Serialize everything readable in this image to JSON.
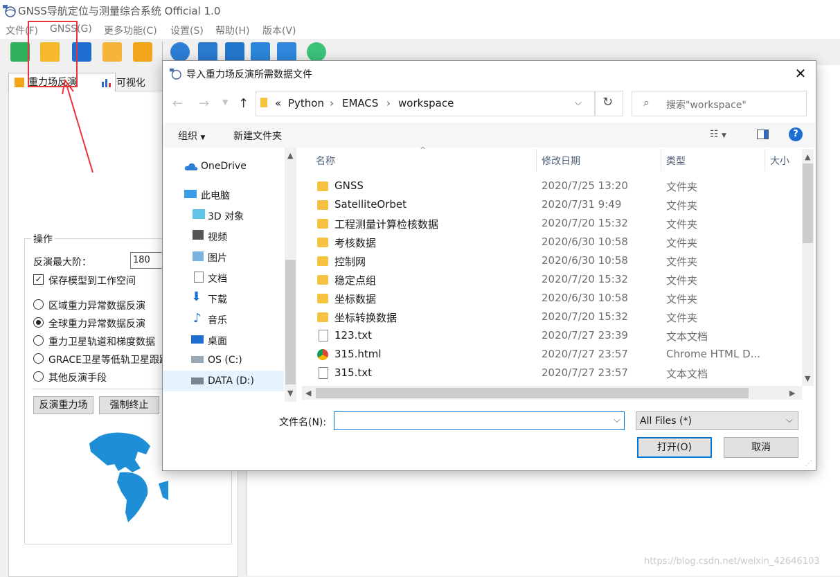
{
  "app": {
    "title": "GNSS导航定位与测量综合系统 Official 1.0",
    "menu": [
      "文件(F)",
      "GNSS(G)",
      "更多功能(C)",
      "设置(S)",
      "帮助(H)",
      "版本(V)"
    ]
  },
  "left_panel": {
    "tabs": [
      "重力场反演",
      "可视化"
    ],
    "group_title": "操作",
    "max_degree_label": "反演最大阶：",
    "max_degree_value": "180",
    "save_model_label": "保存模型到工作空间",
    "save_model_checked": true,
    "options": [
      {
        "label": "区域重力异常数据反演",
        "selected": false
      },
      {
        "label": "全球重力异常数据反演",
        "selected": true
      },
      {
        "label": "重力卫星轨道和梯度数据",
        "selected": false
      },
      {
        "label": "GRACE卫星等低轨卫星跟踪",
        "selected": false
      },
      {
        "label": "其他反演手段",
        "selected": false
      }
    ],
    "invert_button": "反演重力场",
    "stop_button": "强制终止"
  },
  "dialog": {
    "title": "导入重力场反演所需数据文件",
    "breadcrumb_prefix": "«",
    "breadcrumb": [
      "Python",
      "EMACS",
      "workspace"
    ],
    "search_placeholder": "搜索\"workspace\"",
    "organize_label": "组织",
    "new_folder_label": "新建文件夹",
    "nav_items": [
      {
        "label": "OneDrive",
        "icon": "cloud-icon"
      },
      {
        "label": "此电脑",
        "icon": "computer-icon"
      },
      {
        "label": "3D 对象",
        "icon": "cube-icon"
      },
      {
        "label": "视频",
        "icon": "video-icon"
      },
      {
        "label": "图片",
        "icon": "picture-icon"
      },
      {
        "label": "文档",
        "icon": "document-icon"
      },
      {
        "label": "下载",
        "icon": "download-icon"
      },
      {
        "label": "音乐",
        "icon": "music-icon"
      },
      {
        "label": "桌面",
        "icon": "desktop-icon"
      },
      {
        "label": "OS (C:)",
        "icon": "drive-icon"
      },
      {
        "label": "DATA (D:)",
        "icon": "drive-icon"
      }
    ],
    "columns": [
      "名称",
      "修改日期",
      "类型",
      "大小"
    ],
    "files": [
      {
        "name": "GNSS",
        "date": "2020/7/25 13:20",
        "type": "文件夹",
        "icon": "folder-icon"
      },
      {
        "name": "SatelliteOrbet",
        "date": "2020/7/31 9:49",
        "type": "文件夹",
        "icon": "folder-icon"
      },
      {
        "name": "工程测量计算检核数据",
        "date": "2020/7/20 15:32",
        "type": "文件夹",
        "icon": "folder-icon"
      },
      {
        "name": "考核数据",
        "date": "2020/6/30 10:58",
        "type": "文件夹",
        "icon": "folder-icon"
      },
      {
        "name": "控制网",
        "date": "2020/6/30 10:58",
        "type": "文件夹",
        "icon": "folder-icon"
      },
      {
        "name": "稳定点组",
        "date": "2020/7/20 15:32",
        "type": "文件夹",
        "icon": "folder-icon"
      },
      {
        "name": "坐标数据",
        "date": "2020/6/30 10:58",
        "type": "文件夹",
        "icon": "folder-icon"
      },
      {
        "name": "坐标转换数据",
        "date": "2020/7/20 15:32",
        "type": "文件夹",
        "icon": "folder-icon"
      },
      {
        "name": "123.txt",
        "date": "2020/7/27 23:39",
        "type": "文本文档",
        "icon": "text-file-icon"
      },
      {
        "name": "315.html",
        "date": "2020/7/27 23:57",
        "type": "Chrome HTML D...",
        "icon": "chrome-icon"
      },
      {
        "name": "315.txt",
        "date": "2020/7/27 23:57",
        "type": "文本文档",
        "icon": "text-file-icon"
      }
    ],
    "filename_label": "文件名(N):",
    "filename_value": "",
    "filter_value": "All Files (*)",
    "open_button": "打开(O)",
    "cancel_button": "取消"
  },
  "watermark": "https://blog.csdn.net/weixin_42646103"
}
